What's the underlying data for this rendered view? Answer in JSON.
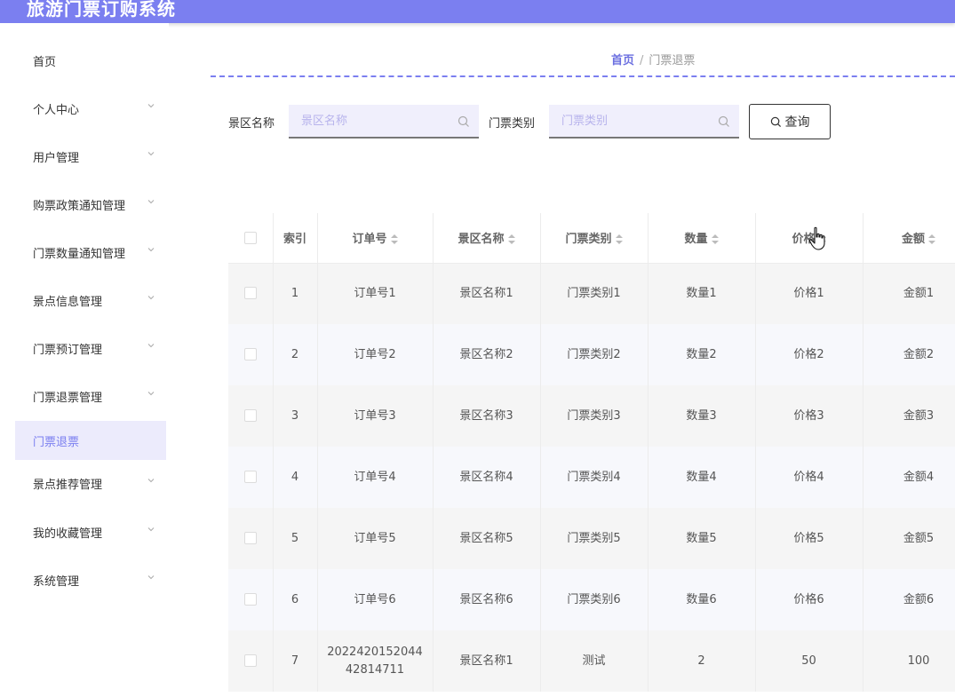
{
  "app": {
    "title": "旅游门票订购系统"
  },
  "sidebar": {
    "items": [
      {
        "label": "首页",
        "has_chevron": false,
        "active": false
      },
      {
        "label": "个人中心",
        "has_chevron": true,
        "active": false
      },
      {
        "label": "用户管理",
        "has_chevron": true,
        "active": false
      },
      {
        "label": "购票政策通知管理",
        "has_chevron": true,
        "active": false
      },
      {
        "label": "门票数量通知管理",
        "has_chevron": true,
        "active": false
      },
      {
        "label": "景点信息管理",
        "has_chevron": true,
        "active": false
      },
      {
        "label": "门票预订管理",
        "has_chevron": true,
        "active": false
      },
      {
        "label": "门票退票管理",
        "has_chevron": true,
        "active": false
      },
      {
        "label": "门票退票",
        "has_chevron": false,
        "active": true
      },
      {
        "label": "景点推荐管理",
        "has_chevron": true,
        "active": false
      },
      {
        "label": "我的收藏管理",
        "has_chevron": true,
        "active": false
      },
      {
        "label": "系统管理",
        "has_chevron": true,
        "active": false
      }
    ]
  },
  "breadcrumb": {
    "home": "首页",
    "separator": "/",
    "current": "门票退票"
  },
  "search": {
    "scenic_label": "景区名称",
    "scenic_placeholder": "景区名称",
    "ticket_label": "门票类别",
    "ticket_placeholder": "门票类别",
    "query_button": "查询"
  },
  "table": {
    "headers": [
      "",
      "索引",
      "订单号",
      "景区名称",
      "门票类别",
      "数量",
      "价格",
      "金额"
    ],
    "rows": [
      {
        "index": "1",
        "order": "订单号1",
        "scenic": "景区名称1",
        "type": "门票类别1",
        "qty": "数量1",
        "price": "价格1",
        "amount": "金额1"
      },
      {
        "index": "2",
        "order": "订单号2",
        "scenic": "景区名称2",
        "type": "门票类别2",
        "qty": "数量2",
        "price": "价格2",
        "amount": "金额2"
      },
      {
        "index": "3",
        "order": "订单号3",
        "scenic": "景区名称3",
        "type": "门票类别3",
        "qty": "数量3",
        "price": "价格3",
        "amount": "金额3"
      },
      {
        "index": "4",
        "order": "订单号4",
        "scenic": "景区名称4",
        "type": "门票类别4",
        "qty": "数量4",
        "price": "价格4",
        "amount": "金额4"
      },
      {
        "index": "5",
        "order": "订单号5",
        "scenic": "景区名称5",
        "type": "门票类别5",
        "qty": "数量5",
        "price": "价格5",
        "amount": "金额5"
      },
      {
        "index": "6",
        "order": "订单号6",
        "scenic": "景区名称6",
        "type": "门票类别6",
        "qty": "数量6",
        "price": "价格6",
        "amount": "金额6"
      },
      {
        "index": "7",
        "order": "2022420152044 42814711",
        "scenic": "景区名称1",
        "type": "测试",
        "qty": "2",
        "price": "50",
        "amount": "100"
      }
    ]
  },
  "colors": {
    "accent": "#7b7ff0",
    "active_bg": "#ecebfc",
    "input_bg": "#f0effc"
  },
  "icons": {
    "chevron": "chevron-down-icon",
    "search": "search-icon",
    "sort": "sort-icon",
    "cursor": "hand-pointer-icon"
  }
}
